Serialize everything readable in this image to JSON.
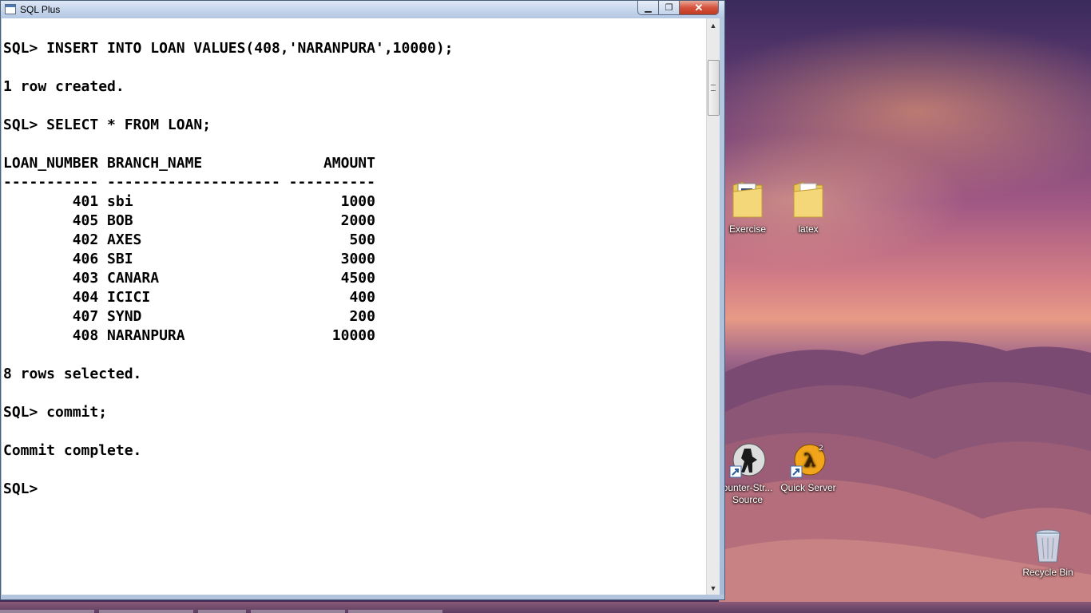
{
  "window": {
    "title": "SQL Plus",
    "controls": {
      "minimize": "▁",
      "maximize": "❐",
      "close": "✕"
    }
  },
  "console": {
    "lines": [
      "SQL> INSERT INTO LOAN VALUES(408,'NARANPURA',10000);",
      "",
      "1 row created.",
      "",
      "SQL> SELECT * FROM LOAN;",
      ""
    ],
    "result_header": {
      "col1": "LOAN_NUMBER",
      "col2": "BRANCH_NAME",
      "col3": "AMOUNT"
    },
    "result_separator": "----------- -------------------- ----------",
    "rows": [
      {
        "loan_number": "401",
        "branch_name": "sbi",
        "amount": "1000"
      },
      {
        "loan_number": "405",
        "branch_name": "BOB",
        "amount": "2000"
      },
      {
        "loan_number": "402",
        "branch_name": "AXES",
        "amount": "500"
      },
      {
        "loan_number": "406",
        "branch_name": "SBI",
        "amount": "3000"
      },
      {
        "loan_number": "403",
        "branch_name": "CANARA",
        "amount": "4500"
      },
      {
        "loan_number": "404",
        "branch_name": "ICICI",
        "amount": "400"
      },
      {
        "loan_number": "407",
        "branch_name": "SYND",
        "amount": "200"
      },
      {
        "loan_number": "408",
        "branch_name": "NARANPURA",
        "amount": "10000"
      }
    ],
    "after_lines": [
      "",
      "8 rows selected.",
      "",
      "SQL> commit;",
      "",
      "Commit complete.",
      "",
      "SQL>"
    ]
  },
  "desktop": {
    "icons": [
      {
        "label": "Exercise",
        "icon": "folder-icon"
      },
      {
        "label": "latex",
        "icon": "folder-icon"
      },
      {
        "label": "ounter-Str...",
        "label2": "Source",
        "icon": "counter-strike-icon"
      },
      {
        "label": "Quick Server",
        "icon": "half-life-icon"
      },
      {
        "label": "Recycle Bin",
        "icon": "recycle-bin-icon"
      }
    ]
  }
}
